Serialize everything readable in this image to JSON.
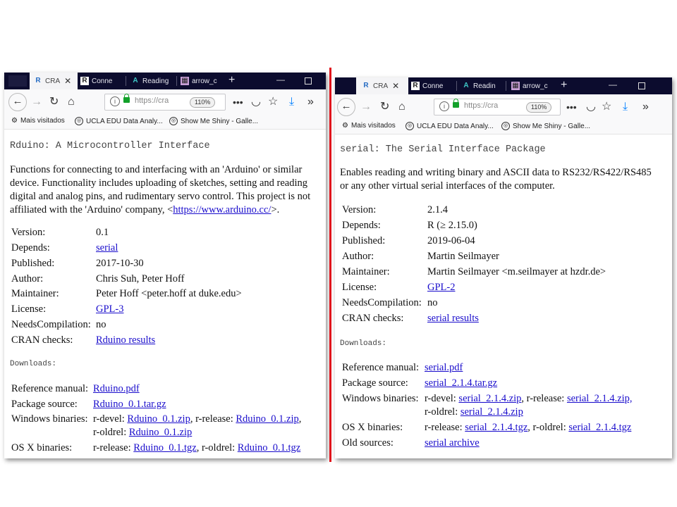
{
  "left": {
    "tabs": [
      {
        "label": "CRA",
        "icon": "r-logo-icon"
      },
      {
        "label": "Conne",
        "icon": "r-box-icon"
      },
      {
        "label": "Reading",
        "icon": "a-logo-icon"
      },
      {
        "label": "arrow_c",
        "icon": "gallery-icon"
      }
    ],
    "url": "https://cra",
    "zoom": "110%",
    "bookmarks": [
      "Mais visitados",
      "UCLA EDU Data Analy...",
      "Show Me Shiny - Galle..."
    ],
    "page": {
      "title": "Rduino: A Microcontroller Interface",
      "description_lines": [
        "Functions for connecting to and interfacing with an 'Arduino' or similar",
        "device. Functionality includes uploading of sketches, setting and reading",
        "digital and analog pins, and rudimentary servo control. This project is not"
      ],
      "description_last_prefix": "affiliated with the 'Arduino' company, <",
      "description_link": "https://www.arduino.cc/",
      "description_last_suffix": ">.",
      "fields": [
        {
          "label": "Version:",
          "value": "0.1"
        },
        {
          "label": "Depends:",
          "value": "serial",
          "link": true
        },
        {
          "label": "Published:",
          "value": "2017-10-30"
        },
        {
          "label": "Author:",
          "value": "Chris Suh, Peter Hoff"
        },
        {
          "label": "Maintainer:",
          "value": "Peter Hoff <peter.hoff at duke.edu>"
        },
        {
          "label": "License:",
          "value": "GPL-3",
          "link": true
        },
        {
          "label": "NeedsCompilation:",
          "value": "no"
        },
        {
          "label": "CRAN checks:",
          "value": "Rduino results",
          "link": true
        }
      ],
      "downloads_heading": "Downloads:",
      "downloads": {
        "ref_label": "Reference manual:",
        "ref_value": "Rduino.pdf",
        "src_label": "Package source:",
        "src_value": "Rduino_0.1.tar.gz",
        "win_label": "Windows binaries:",
        "win_devel_prefix": "r-devel:",
        "win_devel": "Rduino_0.1.zip",
        "win_release_prefix": ", r-release:",
        "win_release": "Rduino_0.1.zip",
        "win_oldrel_prefix": "r-oldrel:",
        "win_oldrel": "Rduino_0.1.zip",
        "osx_label": "OS X binaries:",
        "osx_release_prefix": "r-release:",
        "osx_release": "Rduino_0.1.tgz",
        "osx_oldrel_prefix": ", r-oldrel:",
        "osx_oldrel": "Rduino_0.1.tgz"
      }
    }
  },
  "right": {
    "tabs": [
      {
        "label": "CRA",
        "icon": "r-logo-icon"
      },
      {
        "label": "Conne",
        "icon": "r-box-icon"
      },
      {
        "label": "Readin",
        "icon": "a-logo-icon"
      },
      {
        "label": "arrow_c",
        "icon": "gallery-icon"
      }
    ],
    "url": "https://cra",
    "zoom": "110%",
    "bookmarks": [
      "Mais visitados",
      "UCLA EDU Data Analy...",
      "Show Me Shiny - Galle..."
    ],
    "page": {
      "title": "serial: The Serial Interface Package",
      "description_lines": [
        "Enables reading and writing binary and ASCII data to RS232/RS422/RS485",
        "or any other virtual serial interfaces of the computer."
      ],
      "fields": [
        {
          "label": "Version:",
          "value": "2.1.4"
        },
        {
          "label": "Depends:",
          "value": "R (≥ 2.15.0)"
        },
        {
          "label": "Published:",
          "value": "2019-06-04"
        },
        {
          "label": "Author:",
          "value": "Martin Seilmayer"
        },
        {
          "label": "Maintainer:",
          "value": "Martin Seilmayer <m.seilmayer at hzdr.de>"
        },
        {
          "label": "License:",
          "value": "GPL-2",
          "link": true
        },
        {
          "label": "NeedsCompilation:",
          "value": "no"
        },
        {
          "label": "CRAN checks:",
          "value": "serial results",
          "link": true
        }
      ],
      "downloads_heading": "Downloads:",
      "downloads": {
        "ref_label": "Reference manual:",
        "ref_value": "serial.pdf",
        "src_label": "Package source:",
        "src_value": "serial_2.1.4.tar.gz",
        "win_label": "Windows binaries:",
        "win_devel_prefix": "r-devel:",
        "win_devel": "serial_2.1.4.zip",
        "win_release_prefix": ", r-release:",
        "win_release": "serial_2.1.4.zip,",
        "win_oldrel_prefix": "r-oldrel:",
        "win_oldrel": "serial_2.1.4.zip",
        "osx_label": "OS X binaries:",
        "osx_release_prefix": "r-release:",
        "osx_release": "serial_2.1.4.tgz",
        "osx_oldrel_prefix": ", r-oldrel:",
        "osx_oldrel": "serial_2.1.4.tgz",
        "old_label": "Old sources:",
        "old_value": "serial archive"
      }
    }
  },
  "colors": {
    "divider": "#e0141c",
    "link": "#1a0dcc",
    "tabbar": "#0c0c2e"
  }
}
